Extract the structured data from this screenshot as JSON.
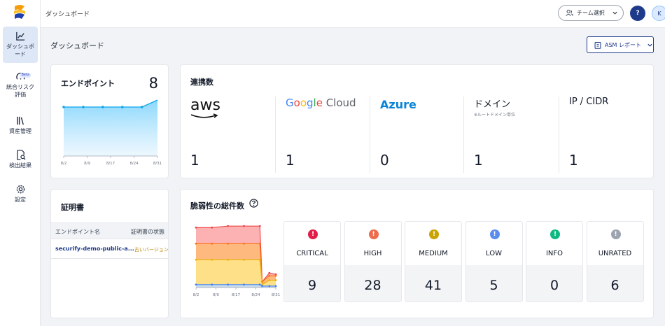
{
  "topbar": {
    "title": "ダッシュボード",
    "team_select": "チーム選択",
    "help": "?",
    "avatar": "K"
  },
  "sidebar": {
    "items": [
      {
        "label": "ダッシュボ\nード",
        "icon": "chart-line-icon"
      },
      {
        "label": "統合リスク\n評価",
        "icon": "risk-gauge-icon",
        "badge": "Beta"
      },
      {
        "label": "資産管理",
        "icon": "library-icon"
      },
      {
        "label": "検出結果",
        "icon": "document-search-icon"
      },
      {
        "label": "設定",
        "icon": "gear-icon"
      }
    ]
  },
  "main": {
    "page_title": "ダッシュボード",
    "report_button": "ASM レポート"
  },
  "endpoint": {
    "title": "エンドポイント",
    "count": "8",
    "chart_data": {
      "type": "area",
      "x": [
        "8/2",
        "8/9",
        "8/17",
        "8/24",
        "8/31"
      ],
      "values": [
        7,
        7,
        7,
        7,
        7,
        8
      ],
      "color": "#7dd3fc"
    }
  },
  "integrations": {
    "title": "連携数",
    "items": [
      {
        "name": "aws",
        "count": "1"
      },
      {
        "name": "Google Cloud",
        "count": "1"
      },
      {
        "name": "Azure",
        "count": "0"
      },
      {
        "name": "ドメイン",
        "sub": "※ルートドメイン単位",
        "count": "1"
      },
      {
        "name": "IP / CIDR",
        "count": "1"
      }
    ]
  },
  "certificate": {
    "title": "証明書",
    "columns": [
      "エンドポイント名",
      "証明書の状態"
    ],
    "rows": [
      {
        "endpoint": "securify-demo-public-a...",
        "status": "古いバージョン"
      }
    ]
  },
  "vulnerability": {
    "title": "脆弱性の総件数",
    "chart_data": {
      "type": "area",
      "x": [
        "8/2",
        "8/9",
        "8/17",
        "8/24",
        "8/31"
      ],
      "series": [
        {
          "color": "#ef4444",
          "values": [
            41,
            41,
            42,
            42,
            42,
            4,
            10,
            9
          ]
        },
        {
          "color": "#f97316",
          "values": [
            30,
            30,
            30,
            30,
            30,
            4,
            8,
            8
          ]
        },
        {
          "color": "#eab308",
          "values": [
            19,
            19,
            19,
            19,
            19,
            2,
            5,
            5
          ]
        },
        {
          "color": "#3b82f6",
          "values": [
            2,
            2,
            2,
            2,
            2,
            1,
            1,
            1
          ]
        }
      ]
    },
    "severities": [
      {
        "label": "CRITICAL",
        "count": "9",
        "color": "#e11d48"
      },
      {
        "label": "HIGH",
        "count": "28",
        "color": "#ef6b4d"
      },
      {
        "label": "MEDIUM",
        "count": "41",
        "color": "#c9a300"
      },
      {
        "label": "LOW",
        "count": "5",
        "color": "#5b8def"
      },
      {
        "label": "INFO",
        "count": "0",
        "color": "#10b981"
      },
      {
        "label": "UNRATED",
        "count": "6",
        "color": "#9ca3af"
      }
    ]
  }
}
